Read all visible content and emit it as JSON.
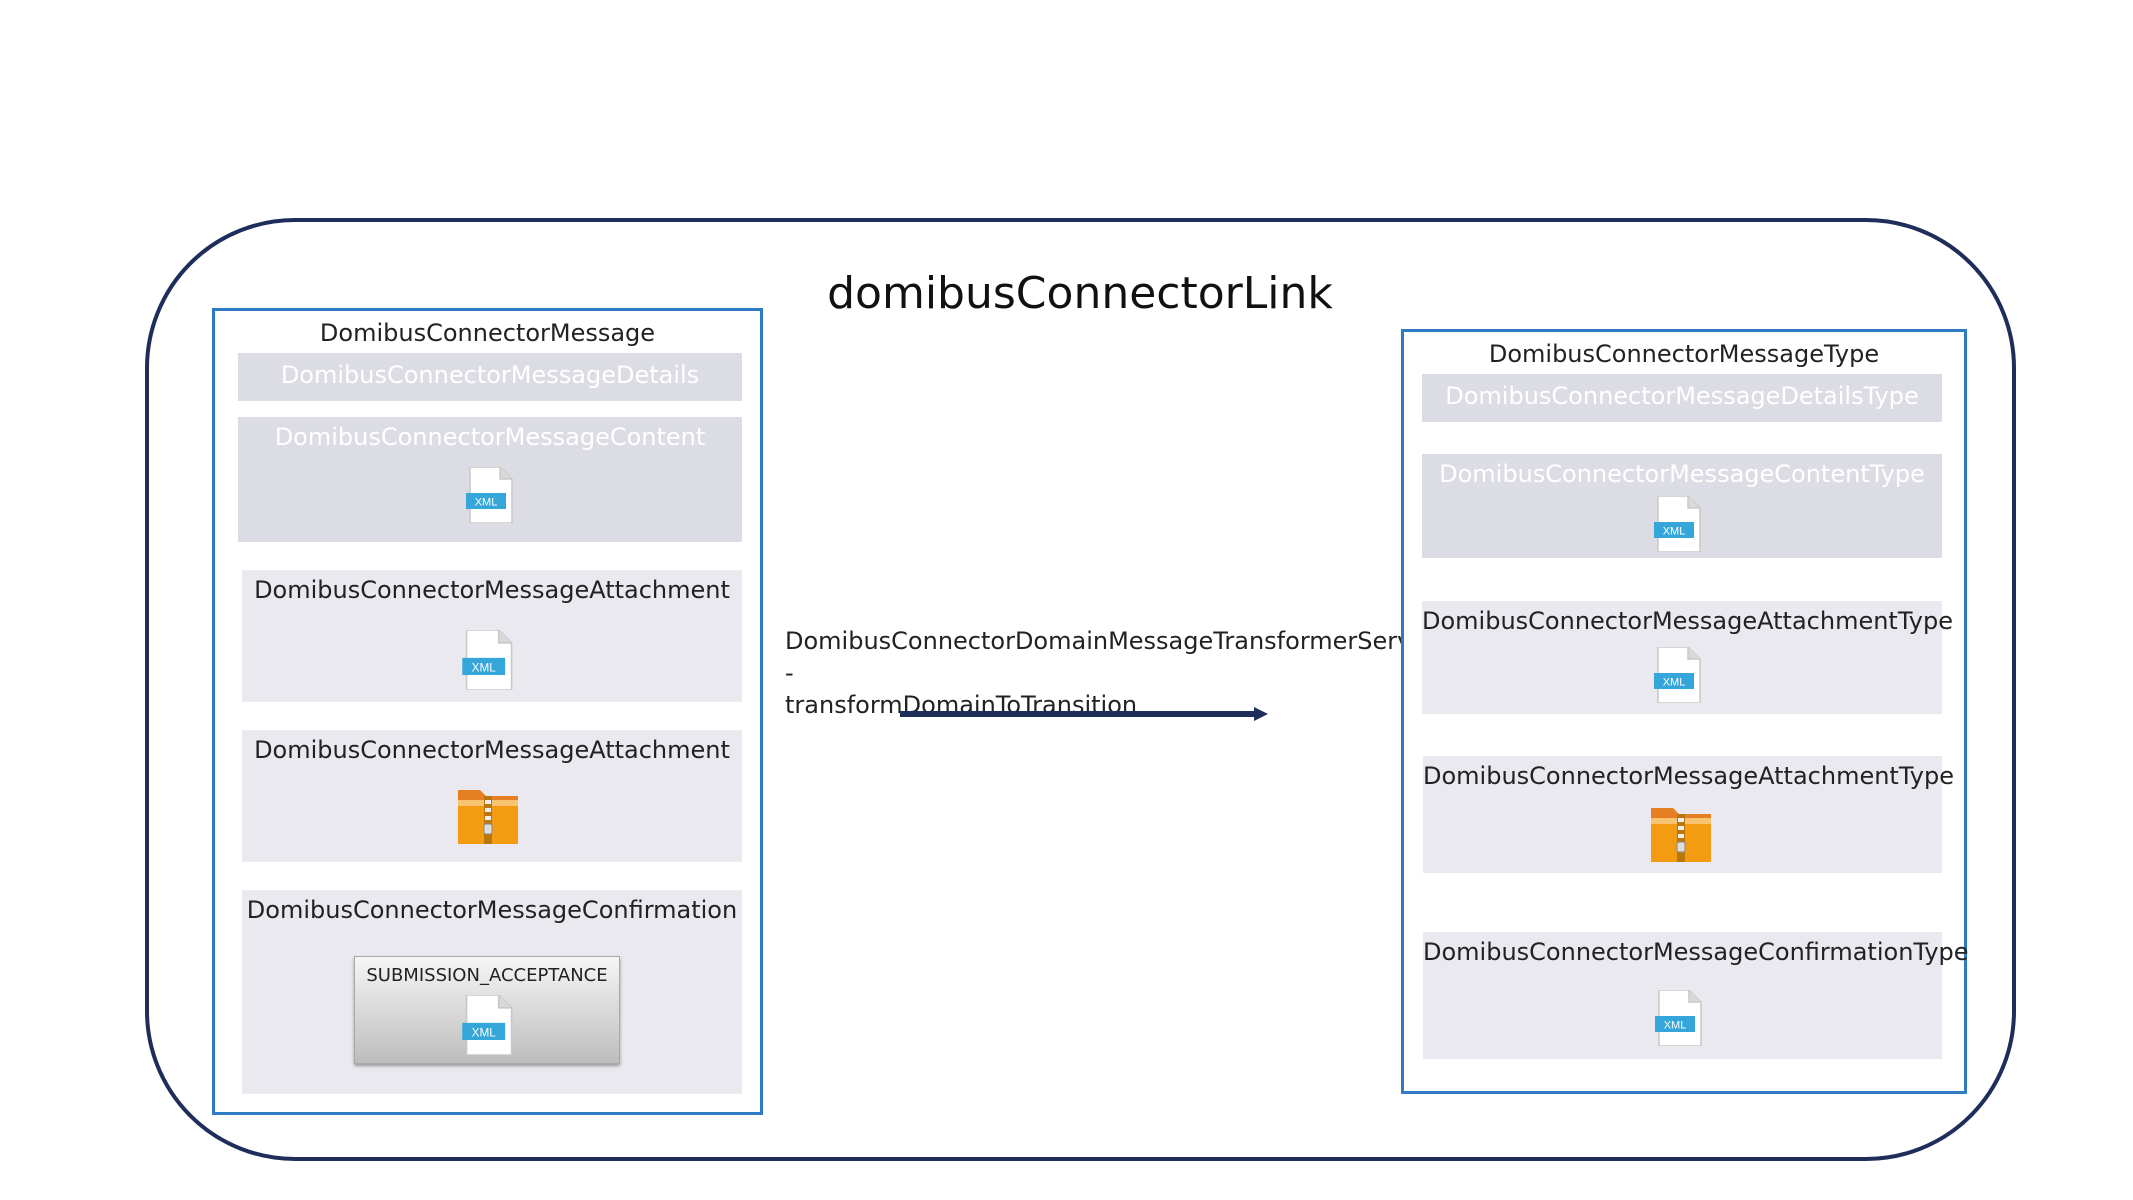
{
  "diagram": {
    "title": "domibusConnectorLink",
    "connector": {
      "label_line1": "DomibusConnectorDomainMessageTransformerService -",
      "label_line2": "transformDomainToTransition"
    },
    "left": {
      "title": "DomibusConnectorMessage",
      "details": "DomibusConnectorMessageDetails",
      "content": "DomibusConnectorMessageContent",
      "attachment_xml": "DomibusConnectorMessageAttachment",
      "attachment_zip": "DomibusConnectorMessageAttachment",
      "confirmation": "DomibusConnectorMessageConfirmation",
      "confirmation_type": "SUBMISSION_ACCEPTANCE"
    },
    "right": {
      "title": "DomibusConnectorMessageType",
      "details": "DomibusConnectorMessageDetailsType",
      "content": "DomibusConnectorMessageContentType",
      "attachment_xml": "DomibusConnectorMessageAttachmentType",
      "attachment_zip": "DomibusConnectorMessageAttachmentType",
      "confirmation": "DomibusConnectorMessageConfirmationType"
    },
    "icons": {
      "xml_text": "XML",
      "xml_icon": "xml-file-icon",
      "zip_icon": "zip-archive-icon"
    },
    "colors": {
      "boundary": "#1f2d5a",
      "box_border": "#2f7bc4",
      "part_fill": "#e9e9ef",
      "xml_badge": "#35a6d9",
      "zip_orange": "#f39c12"
    }
  }
}
